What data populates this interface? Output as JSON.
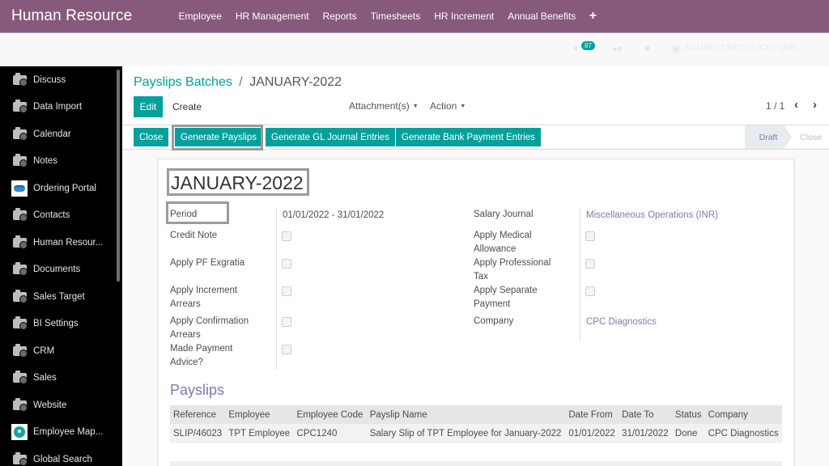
{
  "app": {
    "brand": "Human Resource",
    "top_menu": [
      "Employee",
      "HR Management",
      "Reports",
      "Timesheets",
      "HR Increment",
      "Annual Benefits"
    ],
    "add_menu_icon": "plus-icon"
  },
  "systray": {
    "messages_badge": "87",
    "user_name": "ADMINISTRATOR (CPC-INR)"
  },
  "sidebar": {
    "items": [
      {
        "label": "Discuss",
        "icon": "app-icon"
      },
      {
        "label": "Data Import",
        "icon": "app-icon"
      },
      {
        "label": "Calendar",
        "icon": "app-icon"
      },
      {
        "label": "Notes",
        "icon": "app-icon"
      },
      {
        "label": "Ordering Portal",
        "icon": "handshake-logo"
      },
      {
        "label": "Contacts",
        "icon": "app-icon"
      },
      {
        "label": "Human Resour...",
        "icon": "app-icon"
      },
      {
        "label": "Documents",
        "icon": "app-icon"
      },
      {
        "label": "Sales Target",
        "icon": "app-icon"
      },
      {
        "label": "BI Settings",
        "icon": "app-icon"
      },
      {
        "label": "CRM",
        "icon": "app-icon"
      },
      {
        "label": "Sales",
        "icon": "app-icon"
      },
      {
        "label": "Website",
        "icon": "app-icon"
      },
      {
        "label": "Employee Map...",
        "icon": "map-pin-logo"
      },
      {
        "label": "Global Search",
        "icon": "app-icon"
      }
    ]
  },
  "control_panel": {
    "breadcrumb_parent": "Payslips Batches",
    "breadcrumb_separator": "/",
    "breadcrumb_current": "JANUARY-2022",
    "edit_label": "Edit",
    "create_label": "Create",
    "attachments_label": "Attachment(s)",
    "action_label": "Action",
    "pager": "1 / 1",
    "prev_icon": "‹",
    "next_icon": "›"
  },
  "statusbar": {
    "buttons": [
      "Close",
      "Generate Payslips",
      "Generate GL Journal Entries",
      "Generate Bank Payment Entries"
    ],
    "stages": [
      "Draft",
      "Close"
    ],
    "active_stage": "Draft"
  },
  "form": {
    "title": "JANUARY-2022",
    "left_fields": [
      {
        "label": "Period",
        "value": "01/01/2022 - 31/01/2022"
      },
      {
        "label": "Credit Note",
        "checked": false
      },
      {
        "label": "Apply PF Exgratia",
        "checked": false
      },
      {
        "label": "Apply Increment Arrears",
        "checked": false
      },
      {
        "label": "Apply Confirmation Arrears",
        "checked": false
      },
      {
        "label": "Made Payment Advice?",
        "checked": false
      }
    ],
    "right_fields": [
      {
        "label": "Salary Journal",
        "value": "Miscellaneous Operations (INR)"
      },
      {
        "label": "Apply Medical Allowance",
        "checked": false
      },
      {
        "label": "Apply Professional Tax",
        "checked": false
      },
      {
        "label": "Apply Separate Payment",
        "checked": false
      },
      {
        "label": "Company",
        "value": "CPC Diagnostics"
      }
    ]
  },
  "payslips": {
    "section_title": "Payslips",
    "columns": [
      "Reference",
      "Employee",
      "Employee Code",
      "Payslip Name",
      "Date From",
      "Date To",
      "Status",
      "Company"
    ],
    "rows": [
      [
        "SLIP/46023",
        "TPT Employee",
        "CPC1240",
        "Salary Slip of TPT Employee for January-2022",
        "01/01/2022",
        "31/01/2022",
        "Done",
        "CPC Diagnostics"
      ]
    ]
  },
  "colors": {
    "brand_purple": "#875a7b",
    "accent_teal": "#00a09d",
    "link_purple": "#7c7bad"
  }
}
